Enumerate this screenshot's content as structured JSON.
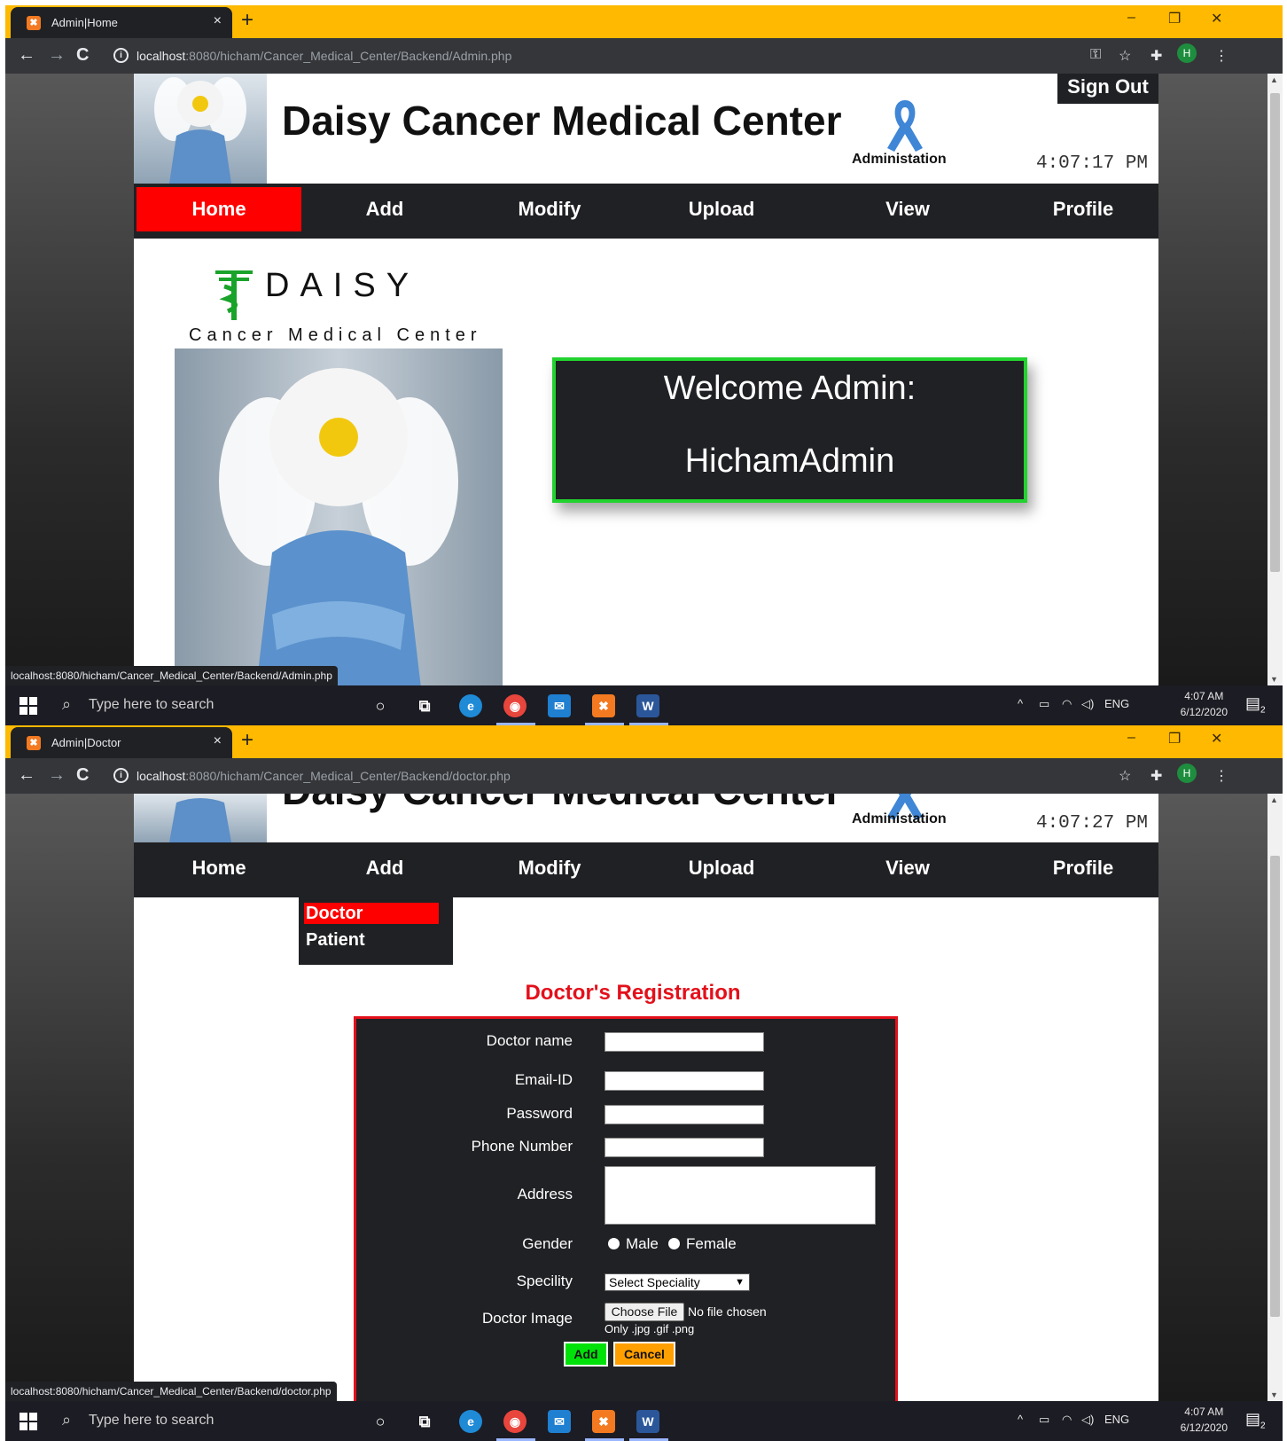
{
  "common": {
    "new_tab": "+",
    "minimize": "–",
    "restore": "❐",
    "close": "✕",
    "tab_close": "×",
    "back": "←",
    "forward": "→",
    "reload": "C",
    "profile_initial": "H",
    "site_title": "Daisy Cancer Medical Center",
    "admin_label": "Administation",
    "menu": [
      "Home",
      "Add",
      "Modify",
      "Upload",
      "View",
      "Profile"
    ],
    "taskbar": {
      "search_placeholder": "Type here to search",
      "lang": "ENG",
      "time": "4:07 AM",
      "date": "6/12/2020",
      "notifications": "2"
    },
    "colors": {
      "chrome_tabbar": "#ffb900",
      "menu_active": "#ff0000",
      "welcome_border": "#22d22f",
      "form_accent": "#e3101b",
      "add_button": "#00e10a",
      "cancel_button": "#ff9f00"
    }
  },
  "shot1": {
    "tab_title": "Admin|Home",
    "url_host": "localhost",
    "url_rest": ":8080/hicham/Cancer_Medical_Center/Backend/Admin.php",
    "clock": "4:07:17 PM",
    "sign_out": "Sign Out",
    "active_menu": "Home",
    "brand": "DAISY",
    "brand_sub": "Cancer Medical Center",
    "welcome_line1": "Welcome Admin:",
    "welcome_line2": "HichamAdmin",
    "status_url": "localhost:8080/hicham/Cancer_Medical_Center/Backend/Admin.php"
  },
  "shot2": {
    "tab_title": "Admin|Doctor",
    "url_host": "localhost",
    "url_rest": ":8080/hicham/Cancer_Medical_Center/Backend/doctor.php",
    "clock": "4:07:27 PM",
    "dropdown": [
      "Doctor",
      "Patient"
    ],
    "active_dropdown": "Doctor",
    "form_title": "Doctor's Registration",
    "labels": {
      "name": "Doctor name",
      "email": "Email-ID",
      "password": "Password",
      "phone": "Phone Number",
      "address": "Address",
      "gender": "Gender",
      "speciality": "Specility",
      "image": "Doctor Image"
    },
    "gender_options": [
      "Male",
      "Female"
    ],
    "speciality_selected": "Select Speciality",
    "file_button": "Choose File",
    "file_status": "No file chosen",
    "file_hint": "Only .jpg .gif .png",
    "add_button": "Add",
    "cancel_button": "Cancel",
    "status_url": "localhost:8080/hicham/Cancer_Medical_Center/Backend/doctor.php"
  }
}
